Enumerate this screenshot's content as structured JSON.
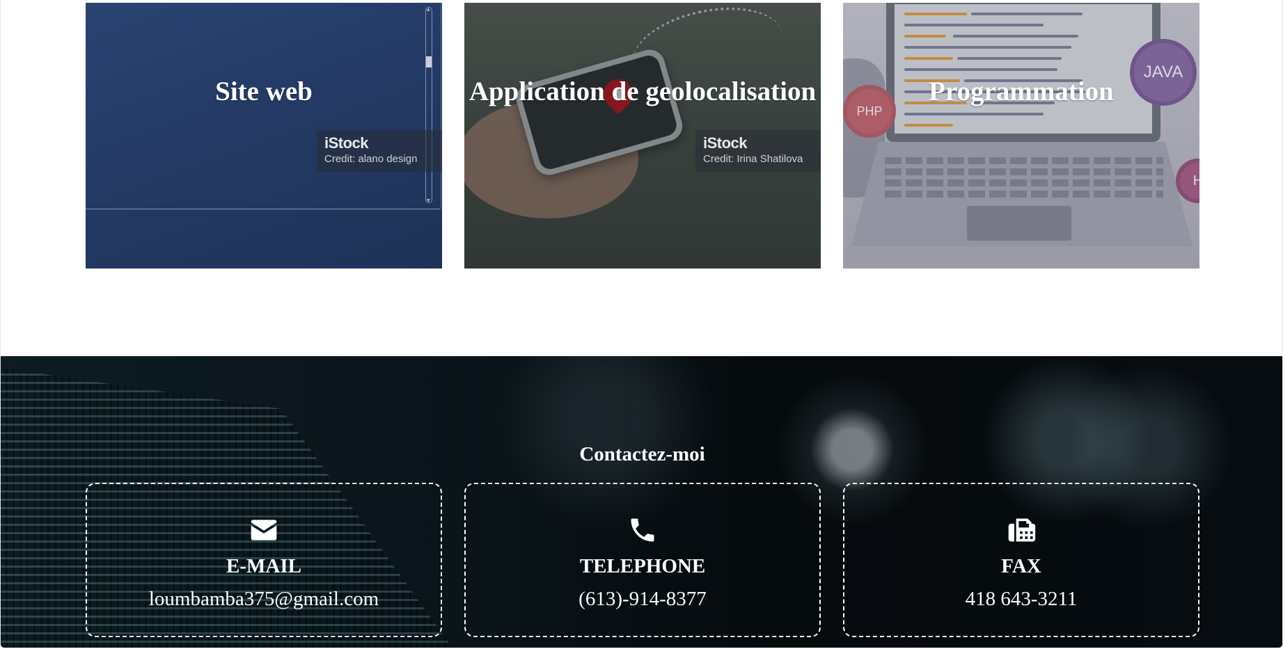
{
  "services": [
    {
      "title": "Site web",
      "credit_brand": "iStock",
      "credit_text": "Credit: alano design"
    },
    {
      "title": "Application de geolocalisation",
      "credit_brand": "iStock",
      "credit_text": "Credit: Irina Shatilova"
    },
    {
      "title": "Programmation",
      "badges": [
        "PHP",
        "JAVA",
        "H"
      ]
    }
  ],
  "contact": {
    "title": "Contactez-moi",
    "items": [
      {
        "label": "E-MAIL",
        "value": "loumbamba375@gmail.com",
        "icon": "envelope-icon"
      },
      {
        "label": "TELEPHONE",
        "value": "(613)-914-8377",
        "icon": "phone-icon"
      },
      {
        "label": "FAX",
        "value": "418 643-3211",
        "icon": "fax-icon"
      }
    ]
  },
  "colors": {
    "card_web": "#243b66",
    "contact_bg": "#070c10",
    "text_light": "#ffffff"
  }
}
